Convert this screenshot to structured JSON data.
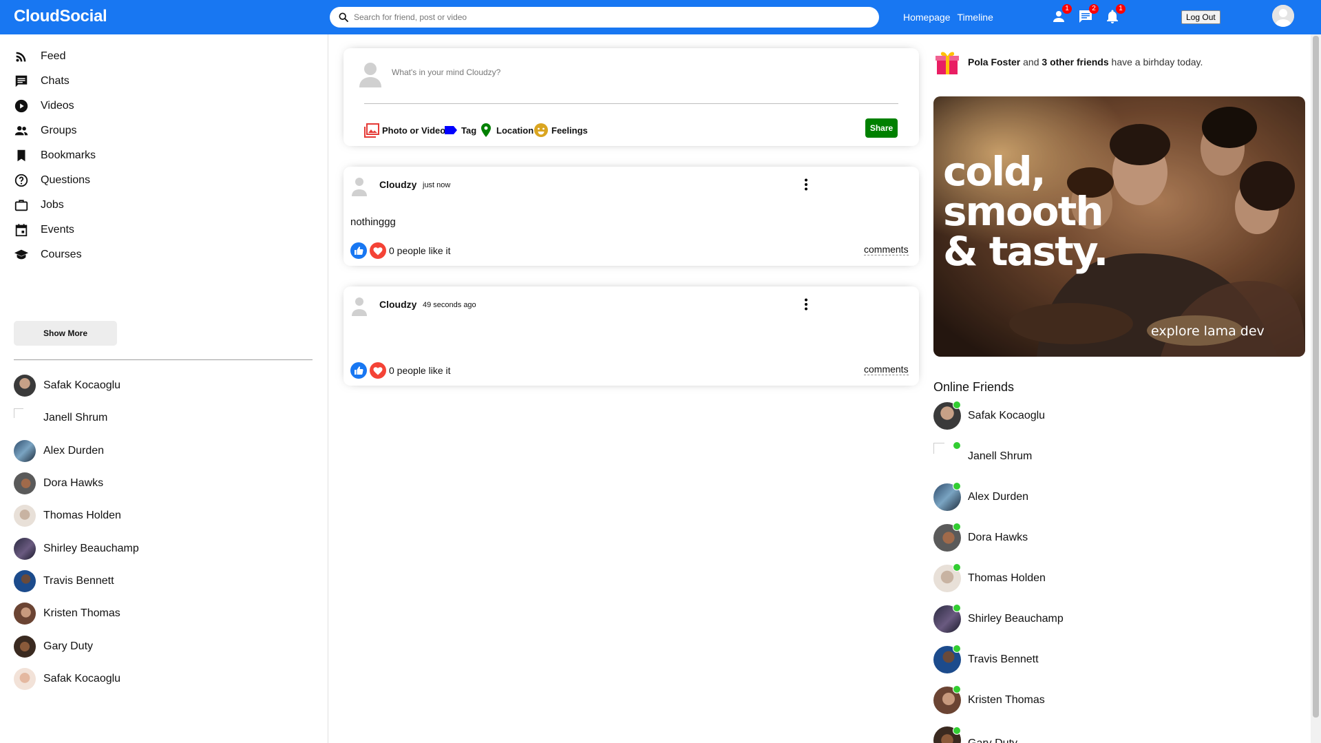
{
  "app": {
    "title": "CloudSocial"
  },
  "topbar": {
    "search_placeholder": "Search for friend, post or video",
    "links": [
      "Homepage",
      "Timeline"
    ],
    "badges": {
      "friends": "1",
      "chats": "2",
      "notifications": "1"
    },
    "logout_label": "Log Out",
    "color": "#1877f2"
  },
  "sidebar": {
    "items": [
      {
        "label": "Feed",
        "icon": "rss-feed-icon"
      },
      {
        "label": "Chats",
        "icon": "chat-icon"
      },
      {
        "label": "Videos",
        "icon": "play-circle-icon"
      },
      {
        "label": "Groups",
        "icon": "group-icon"
      },
      {
        "label": "Bookmarks",
        "icon": "bookmark-icon"
      },
      {
        "label": "Questions",
        "icon": "help-outline-icon"
      },
      {
        "label": "Jobs",
        "icon": "work-outline-icon"
      },
      {
        "label": "Events",
        "icon": "event-icon"
      },
      {
        "label": "Courses",
        "icon": "school-icon"
      }
    ],
    "show_more_label": "Show More",
    "friends": [
      "Safak Kocaoglu",
      "Janell Shrum",
      "Alex Durden",
      "Dora Hawks",
      "Thomas Holden",
      "Shirley Beauchamp",
      "Travis Bennett",
      "Kristen Thomas",
      "Gary Duty",
      "Safak Kocaoglu"
    ]
  },
  "share": {
    "placeholder": "What's in your mind Cloudzy?",
    "options": [
      "Photo or Video",
      "Tag",
      "Location",
      "Feelings"
    ],
    "share_label": "Share",
    "share_color": "#008000"
  },
  "posts": [
    {
      "author": "Cloudzy",
      "time": "just now",
      "text": "nothinggg",
      "likes": "0 people like it",
      "comments": "comments"
    },
    {
      "author": "Cloudzy",
      "time": "49 seconds ago",
      "text": "",
      "likes": "0 people like it",
      "comments": "comments"
    }
  ],
  "rightbar": {
    "birthday": {
      "name": "Pola Foster",
      "and": "and",
      "others": "3 other friends",
      "rest": "have a birhday today."
    },
    "ad": {
      "line1": "cold,",
      "line2": "smooth",
      "line3": "& tasty.",
      "tagline": "explore lama dev"
    },
    "online_title": "Online Friends",
    "online_friends": [
      "Safak Kocaoglu",
      "Janell Shrum",
      "Alex Durden",
      "Dora Hawks",
      "Thomas Holden",
      "Shirley Beauchamp",
      "Travis Bennett",
      "Kristen Thomas",
      "Gary Duty"
    ],
    "online_color": "#32cd32"
  }
}
